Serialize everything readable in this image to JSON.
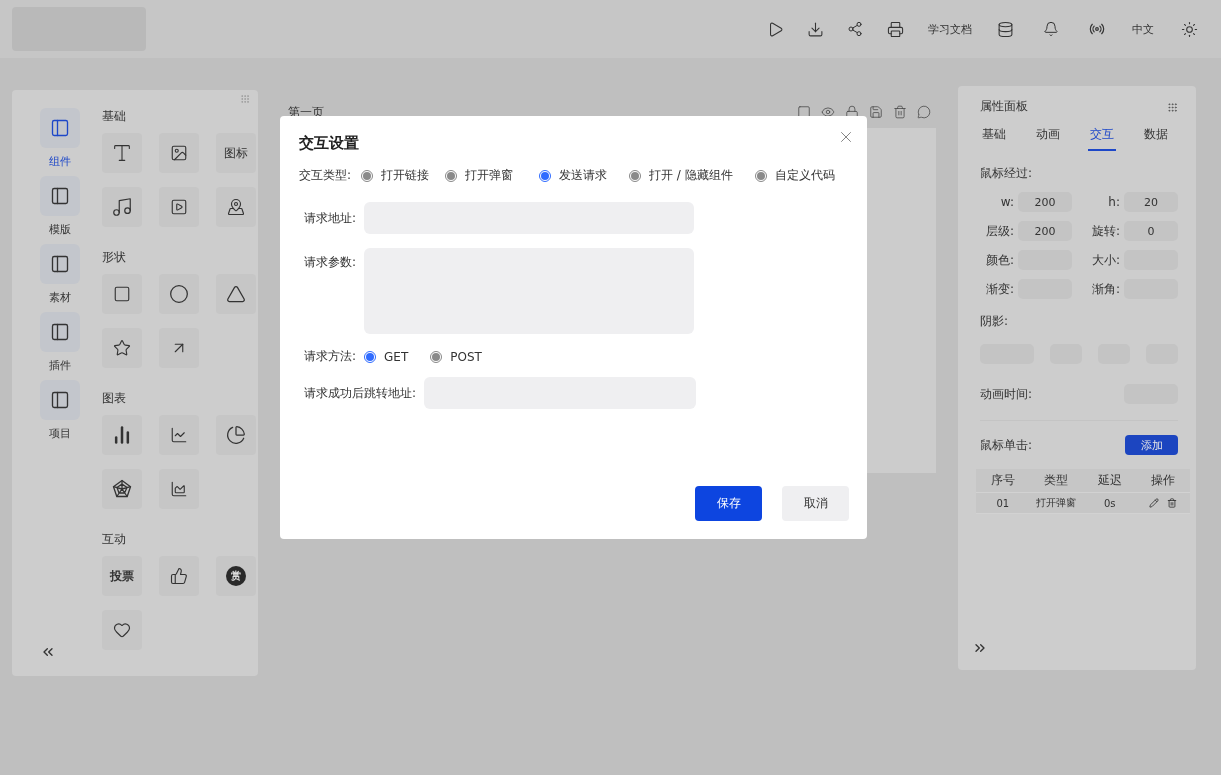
{
  "topbar": {
    "doc_link": "学习文档",
    "language": "中文"
  },
  "left_nav": [
    {
      "label": "组件",
      "selected": true
    },
    {
      "label": "模版",
      "selected": false
    },
    {
      "label": "素材",
      "selected": false
    },
    {
      "label": "插件",
      "selected": false
    },
    {
      "label": "项目",
      "selected": false
    }
  ],
  "component_groups": [
    {
      "title": "基础",
      "items": [
        {
          "kind": "icon"
        },
        {
          "kind": "icon"
        },
        {
          "kind": "text",
          "label": "图标"
        },
        {
          "kind": "icon"
        },
        {
          "kind": "icon"
        },
        {
          "kind": "icon"
        }
      ]
    },
    {
      "title": "形状",
      "items": [
        {
          "kind": "icon"
        },
        {
          "kind": "icon"
        },
        {
          "kind": "icon"
        },
        {
          "kind": "icon"
        },
        {
          "kind": "icon"
        }
      ]
    },
    {
      "title": "图表",
      "items": [
        {
          "kind": "icon"
        },
        {
          "kind": "icon"
        },
        {
          "kind": "icon"
        },
        {
          "kind": "icon"
        },
        {
          "kind": "icon"
        }
      ]
    },
    {
      "title": "互动",
      "items": [
        {
          "kind": "text",
          "label": "投票"
        },
        {
          "kind": "icon"
        },
        {
          "kind": "badge",
          "label": "赏"
        },
        {
          "kind": "icon"
        }
      ]
    }
  ],
  "canvas": {
    "page_title": "第一页"
  },
  "modal": {
    "title": "交互设置",
    "type_label": "交互类型:",
    "types": [
      {
        "label": "打开链接",
        "selected": false
      },
      {
        "label": "打开弹窗",
        "selected": false
      },
      {
        "label": "发送请求",
        "selected": true
      },
      {
        "label": "打开 / 隐藏组件",
        "selected": false
      },
      {
        "label": "自定义代码",
        "selected": false
      }
    ],
    "fields": [
      {
        "kind": "input",
        "label": "请求地址:"
      },
      {
        "kind": "textarea",
        "label": "请求参数:"
      },
      {
        "kind": "radio",
        "label": "请求方法:",
        "options": [
          {
            "label": "GET",
            "selected": true
          },
          {
            "label": "POST",
            "selected": false
          }
        ]
      },
      {
        "kind": "input",
        "label": "请求成功后跳转地址:"
      }
    ],
    "buttons": [
      {
        "label": "保存",
        "kind": "primary"
      },
      {
        "label": "取消",
        "kind": "secondary"
      }
    ]
  },
  "properties": {
    "title": "属性面板",
    "tabs": [
      {
        "label": "基础",
        "selected": false
      },
      {
        "label": "动画",
        "selected": false
      },
      {
        "label": "交互",
        "selected": true
      },
      {
        "label": "数据",
        "selected": false
      }
    ],
    "hover_label": "鼠标经过:",
    "props": [
      {
        "label": "w:",
        "value": "200"
      },
      {
        "label": "h:",
        "value": "20"
      },
      {
        "label": "层级:",
        "value": "200"
      },
      {
        "label": "旋转:",
        "value": "0"
      },
      {
        "label": "颜色:"
      },
      {
        "label": "大小:"
      },
      {
        "label": "渐变:"
      },
      {
        "label": "渐角:"
      }
    ],
    "shadow_label": "阴影:",
    "duration_label": "动画时间:",
    "click_label": "鼠标单击:",
    "add_button": "添加",
    "table": {
      "columns": [
        "序号",
        "类型",
        "延迟",
        "操作"
      ],
      "rows": [
        {
          "index": "01",
          "type": "打开弹窗",
          "delay": "0s"
        }
      ]
    }
  }
}
